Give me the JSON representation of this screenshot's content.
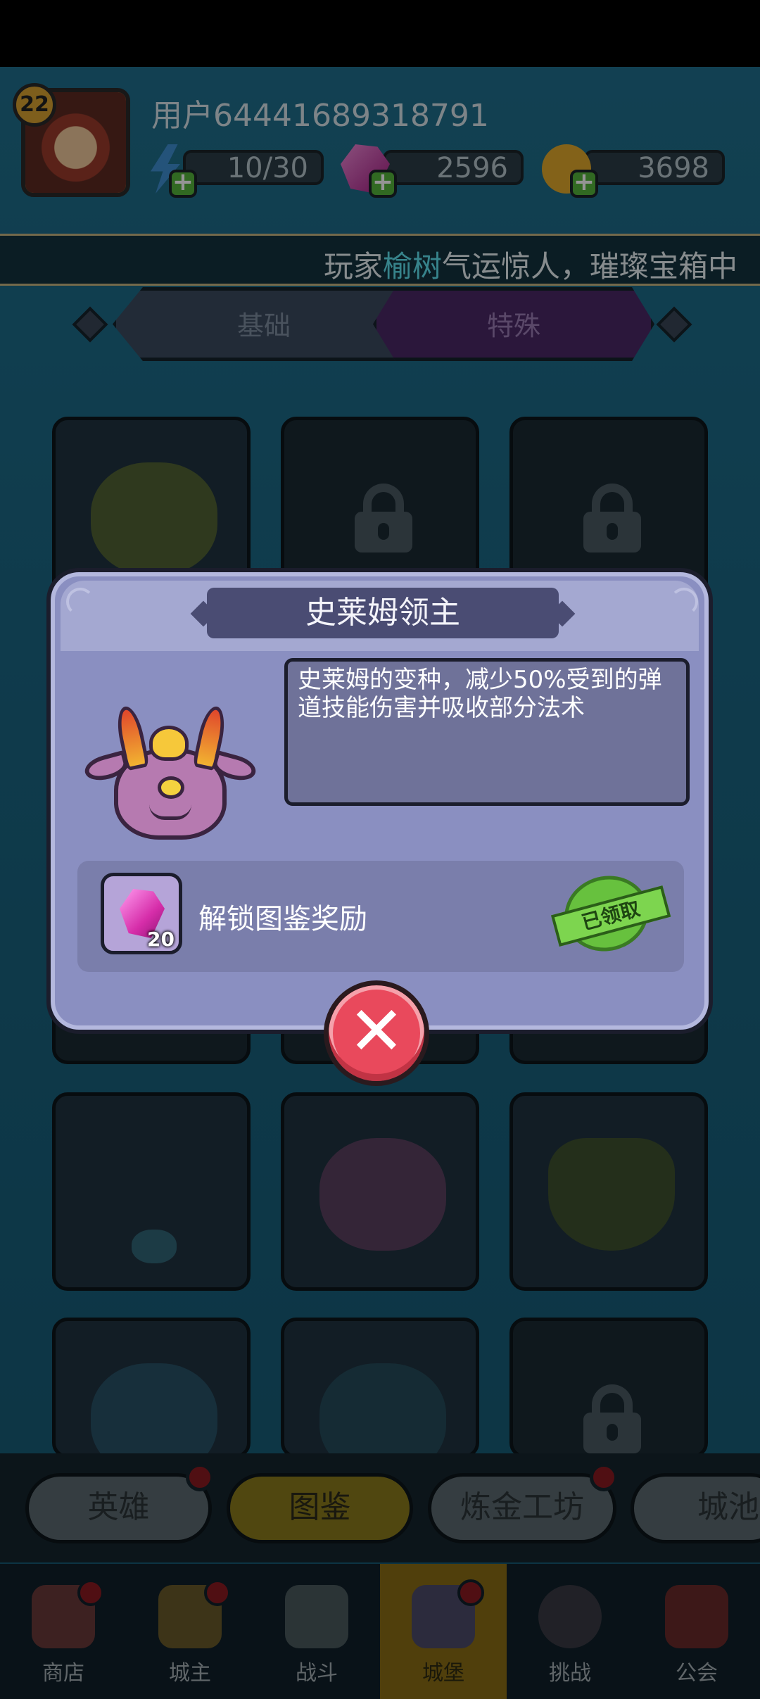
{
  "player": {
    "level": "22",
    "username": "用户64441689318791"
  },
  "resources": {
    "energy": "10/30",
    "gems": "2596",
    "gold": "3698"
  },
  "ticker": {
    "prefix": "玩家",
    "name": "榆树",
    "suffix": "气运惊人，璀璨宝箱中"
  },
  "tabs": {
    "basic": "基础",
    "special": "特殊"
  },
  "popup": {
    "title": "史莱姆领主",
    "description": "史莱姆的变种，减少50%受到的弹道技能伤害并吸收部分法术",
    "reward_label": "解锁图鉴奖励",
    "reward_count": "20",
    "claimed": "已领取",
    "close_icon": "close-icon"
  },
  "subnav": [
    "英雄",
    "图鉴",
    "炼金工坊",
    "城池"
  ],
  "bottomnav": [
    "商店",
    "城主",
    "战斗",
    "城堡",
    "挑战",
    "公会"
  ],
  "colors": {
    "popup_bg": "#8a8fc1",
    "close_button": "#e9495c",
    "claimed_stamp": "#67c13e",
    "ticker_highlight": "#5fe2f0"
  }
}
